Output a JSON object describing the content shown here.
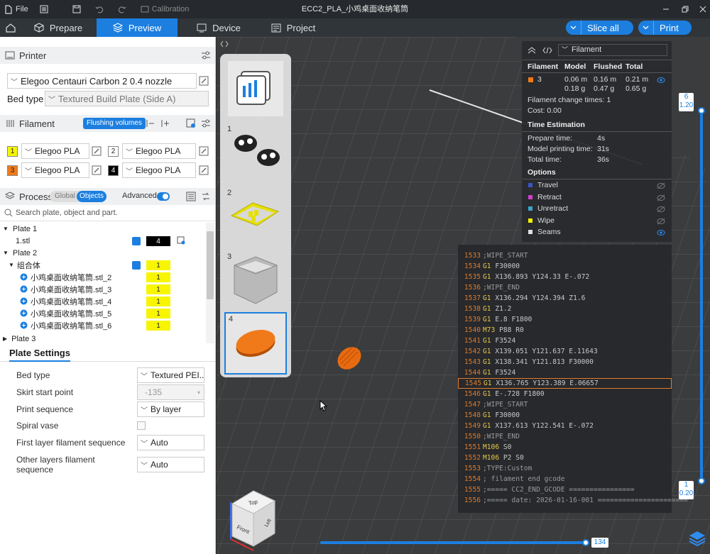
{
  "titlebar": {
    "file": "File",
    "calibration": "Calibration",
    "title": "ECC2_PLA_小鸡桌面收纳笔筒"
  },
  "tabs": [
    {
      "label": "Prepare"
    },
    {
      "label": "Preview"
    },
    {
      "label": "Device"
    },
    {
      "label": "Project"
    }
  ],
  "actions": {
    "slice_all": "Slice all",
    "print": "Print"
  },
  "printer": {
    "header": "Printer",
    "model": "Elegoo Centauri Carbon 2 0.4 nozzle",
    "bed_type_label": "Bed type",
    "bed_type": "Textured Build Plate (Side A)"
  },
  "filament": {
    "header": "Filament",
    "flushing": "Flushing volumes",
    "slots": [
      {
        "num": "1",
        "color": "#f7f500",
        "name": "Elegoo PLA"
      },
      {
        "num": "2",
        "color": "#ffffff",
        "name": "Elegoo PLA"
      },
      {
        "num": "3",
        "color": "#f07a1a",
        "name": "Elegoo PLA"
      },
      {
        "num": "4",
        "color": "#000000",
        "name": "Elegoo PLA"
      }
    ]
  },
  "process": {
    "header": "Process",
    "global": "Global",
    "objects": "Objects",
    "advanced": "Advanced",
    "search_placeholder": "Search plate, object and part."
  },
  "tree": [
    {
      "label": "Plate 1",
      "level": 0,
      "num": ""
    },
    {
      "label": "1.stl",
      "level": 1,
      "num": "4"
    },
    {
      "label": "Plate 2",
      "level": 0,
      "num": ""
    },
    {
      "label": "组合体",
      "level": 1,
      "num": "1"
    },
    {
      "label": "小鸡桌面收纳笔筒.stl_2",
      "level": 2,
      "num": "1"
    },
    {
      "label": "小鸡桌面收纳笔筒.stl_3",
      "level": 2,
      "num": "1"
    },
    {
      "label": "小鸡桌面收纳笔筒.stl_4",
      "level": 2,
      "num": "1"
    },
    {
      "label": "小鸡桌面收纳笔筒.stl_5",
      "level": 2,
      "num": "1"
    },
    {
      "label": "小鸡桌面收纳笔筒.stl_6",
      "level": 2,
      "num": "1"
    },
    {
      "label": "Plate 3",
      "level": 0,
      "num": ""
    }
  ],
  "plate_settings": {
    "tab": "Plate Settings",
    "rows": [
      {
        "label": "Bed type",
        "value": "Textured PEI..."
      },
      {
        "label": "Skirt start point",
        "value": "-135"
      },
      {
        "label": "Print sequence",
        "value": "By layer"
      },
      {
        "label": "Spiral vase",
        "value": ""
      },
      {
        "label": "First layer filament sequence",
        "value": "Auto"
      },
      {
        "label": "Other layers filament sequence",
        "value": "Auto"
      }
    ]
  },
  "plates": [
    {
      "num": "1"
    },
    {
      "num": "2"
    },
    {
      "num": "3"
    },
    {
      "num": "4"
    }
  ],
  "legend": {
    "dropdown": "Filament",
    "headers": [
      "Filament",
      "Model",
      "Flushed",
      "Total"
    ],
    "filament_num": "3",
    "model": [
      "0.06 m",
      "0.18 g"
    ],
    "flushed": [
      "0.16 m",
      "0.47 g"
    ],
    "total": [
      "0.21 m",
      "0.65 g"
    ],
    "change_times": "Filament change times:  1",
    "cost": "Cost:  0.00",
    "time_header": "Time Estimation",
    "times": [
      {
        "label": "Prepare time:",
        "value": "4s"
      },
      {
        "label": "Model printing time:",
        "value": "31s"
      },
      {
        "label": "Total time:",
        "value": "36s"
      }
    ],
    "options_header": "Options",
    "options": [
      {
        "label": "Travel",
        "color": "#3a55c8"
      },
      {
        "label": "Retract",
        "color": "#d23fd0"
      },
      {
        "label": "Unretract",
        "color": "#3aa6c8"
      },
      {
        "label": "Wipe",
        "color": "#f2f200"
      },
      {
        "label": "Seams",
        "color": "#e0e0e0"
      }
    ]
  },
  "gcode": [
    {
      "n": "1533",
      "cmd": "",
      "args": ";WIPE_START"
    },
    {
      "n": "1534",
      "cmd": "G1",
      "args": " F30000"
    },
    {
      "n": "1535",
      "cmd": "G1",
      "args": " X136.893 Y124.33 E-.072"
    },
    {
      "n": "1536",
      "cmd": "",
      "args": ";WIPE_END"
    },
    {
      "n": "1537",
      "cmd": "G1",
      "args": " X136.294 Y124.394 Z1.6"
    },
    {
      "n": "1538",
      "cmd": "G1",
      "args": " Z1.2"
    },
    {
      "n": "1539",
      "cmd": "G1",
      "args": " E.8 F1800"
    },
    {
      "n": "1540",
      "cmd": "M73",
      "args": " P88 R0"
    },
    {
      "n": "1541",
      "cmd": "G1",
      "args": " F3524"
    },
    {
      "n": "1542",
      "cmd": "G1",
      "args": " X139.051 Y121.637 E.11643"
    },
    {
      "n": "1543",
      "cmd": "G1",
      "args": " X138.341 Y121.813 F30000"
    },
    {
      "n": "1544",
      "cmd": "G1",
      "args": " F3524"
    },
    {
      "n": "1545",
      "cmd": "G1",
      "args": " X136.765 Y123.389 E.06657"
    },
    {
      "n": "1546",
      "cmd": "G1",
      "args": " E-.728 F1800"
    },
    {
      "n": "1547",
      "cmd": "",
      "args": ";WIPE_START"
    },
    {
      "n": "1548",
      "cmd": "G1",
      "args": " F30000"
    },
    {
      "n": "1549",
      "cmd": "G1",
      "args": " X137.613 Y122.541 E-.072"
    },
    {
      "n": "1550",
      "cmd": "",
      "args": ";WIPE_END"
    },
    {
      "n": "1551",
      "cmd": "M106",
      "args": " S0"
    },
    {
      "n": "1552",
      "cmd": "M106",
      "args": " P2 S0"
    },
    {
      "n": "1553",
      "cmd": "",
      "args": ";TYPE:Custom"
    },
    {
      "n": "1554",
      "cmd": "",
      "args": "; filament end gcode"
    },
    {
      "n": "1555",
      "cmd": "",
      "args": ";===== CC2_END_GCODE ================"
    },
    {
      "n": "1556",
      "cmd": "",
      "args": ";===== date: 2026-01-16-001 ======================"
    }
  ],
  "layer_slider": {
    "top_layer": "6",
    "top_height": "1.20",
    "bottom_layer": "1",
    "bottom_height": "0.20"
  },
  "move_slider": {
    "value": "134"
  },
  "viewcube": {
    "top": "Top",
    "front": "Front",
    "left": "Left"
  }
}
